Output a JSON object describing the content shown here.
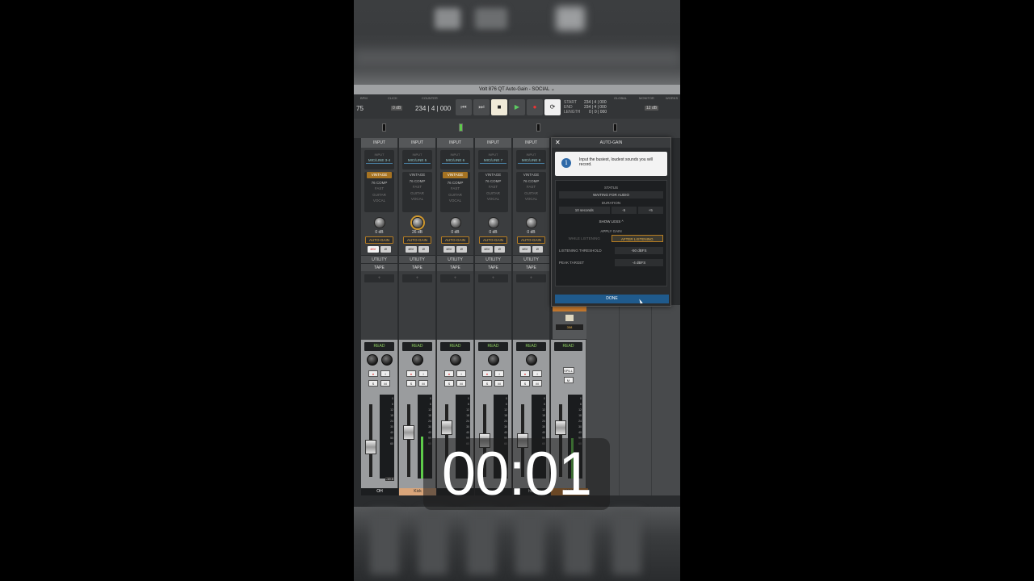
{
  "window": {
    "title": "Volt 876 QT Auto-Gain - SOCIAL ⌄"
  },
  "transport": {
    "bpm_label": "BPM",
    "bpm": "75",
    "click_label": "CLICK",
    "click_val": "0 dB",
    "counter_label": "COUNTER",
    "counter": "234 | 4 | 000",
    "start_label": "START",
    "end_label": "END",
    "length_label": "LENGTH",
    "start_val": "234 | 4 | 000",
    "end_val": "234 | 4 | 000",
    "length_val": "0 | 0 | 000",
    "global_label": "GLOBAL",
    "monitor_label": "MONITOR",
    "monitor_val": "12 dB",
    "workspace_label": "WORKS"
  },
  "channels": [
    {
      "hdr": "INPUT",
      "src_top": "INPUT",
      "src": "MIC/LINE 3-4",
      "pre": [
        "VINTAGE",
        "76 COMP",
        "FAST",
        "GUITAR",
        "VOCAL"
      ],
      "sel": 0,
      "gain": "0 dB",
      "autogain": "AUTO-GAIN",
      "p48": "48V",
      "phase": "Ø",
      "utility": "UTILITY",
      "tape": "TAPE",
      "slot": "+"
    },
    {
      "hdr": "INPUT",
      "src_top": "INPUT",
      "src": "MIC/LINE 5",
      "pre": [
        "VINTAGE",
        "76 COMP",
        "FAST",
        "GUITAR",
        "VOCAL"
      ],
      "sel": 1,
      "gain": "26 dB",
      "autogain": "AUTO-GAIN",
      "p48": "48V",
      "phase": "Ø",
      "utility": "UTILITY",
      "tape": "TAPE",
      "slot": "+"
    },
    {
      "hdr": "INPUT",
      "src_top": "INPUT",
      "src": "MIC/LINE 6",
      "pre": [
        "VINTAGE",
        "76 COMP",
        "FAST",
        "GUITAR",
        "VOCAL"
      ],
      "sel": 0,
      "gain": "0 dB",
      "autogain": "AUTO-GAIN",
      "p48": "48V",
      "phase": "Ø",
      "utility": "UTILITY",
      "tape": "TAPE",
      "slot": "+"
    },
    {
      "hdr": "INPUT",
      "src_top": "INPUT",
      "src": "MIC/LINE 7",
      "pre": [
        "VINTAGE",
        "76 COMP",
        "FAST",
        "GUITAR",
        "VOCAL"
      ],
      "sel": 1,
      "gain": "0 dB",
      "autogain": "AUTO-GAIN",
      "p48": "48V",
      "phase": "Ø",
      "utility": "UTILITY",
      "tape": "TAPE",
      "slot": "+"
    },
    {
      "hdr": "INPUT",
      "src_top": "INPUT",
      "src": "MIC/LINE 8",
      "pre": [
        "VINTAGE",
        "76 COMP",
        "FAST",
        "GUITAR",
        "VOCAL"
      ],
      "sel": 1,
      "gain": "0 dB",
      "autogain": "AUTO-GAIN",
      "p48": "48V",
      "phase": "Ø",
      "utility": "UTILITY",
      "tape": "TAPE",
      "slot": "+"
    }
  ],
  "faders": [
    {
      "read": "READ",
      "rec": "●",
      "input": "I",
      "solo": "S",
      "mute": "M",
      "name": "OH",
      "readout": "-19.5"
    },
    {
      "read": "READ",
      "rec": "●",
      "input": "I",
      "solo": "S",
      "mute": "M",
      "name": "Kick",
      "readout": ""
    },
    {
      "read": "READ",
      "rec": "●",
      "input": "I",
      "solo": "S",
      "mute": "M",
      "name": "",
      "readout": ""
    },
    {
      "read": "READ",
      "rec": "●",
      "input": "I",
      "solo": "S",
      "mute": "M",
      "name": "",
      "readout": ""
    },
    {
      "read": "READ",
      "rec": "●",
      "input": "I",
      "solo": "S",
      "mute": "M",
      "name": "hoo",
      "readout": ""
    },
    {
      "read": "READ",
      "spill": "SPILL",
      "mute": "M",
      "name": "MAIN",
      "readout": ""
    }
  ],
  "meter_scale": [
    "0",
    "6",
    "12",
    "18",
    "24",
    "30",
    "40",
    "50",
    "60"
  ],
  "dialog": {
    "title": "AUTO-GAIN",
    "close": "✕",
    "info_icon": "i",
    "info_text": "Input the busiest, loudest sounds you will record.",
    "status_label": "STATUS",
    "status_value": "WAITING FOR AUDIO",
    "duration_label": "DURATION",
    "duration_value": "10 seconds",
    "duration_minus": "-5",
    "duration_plus": "+5",
    "show_less": "SHOW LESS ^",
    "apply_gain_label": "APPLY GAIN",
    "while_listening": "WHILE LISTENING",
    "after_listening": "AFTER LISTENING",
    "threshold_label": "LISTENING THRESHOLD",
    "threshold_value": "-50 dBFS",
    "peak_label": "PEAK TARGET",
    "peak_value": "-4 dBFS",
    "done": "DONE"
  },
  "side_strip": {
    "value": "358"
  },
  "timer": "00:01",
  "colors": {
    "accent_orange": "#b67d22",
    "done_blue": "#1f5a8c",
    "meter_green": "#5ecb4a"
  }
}
